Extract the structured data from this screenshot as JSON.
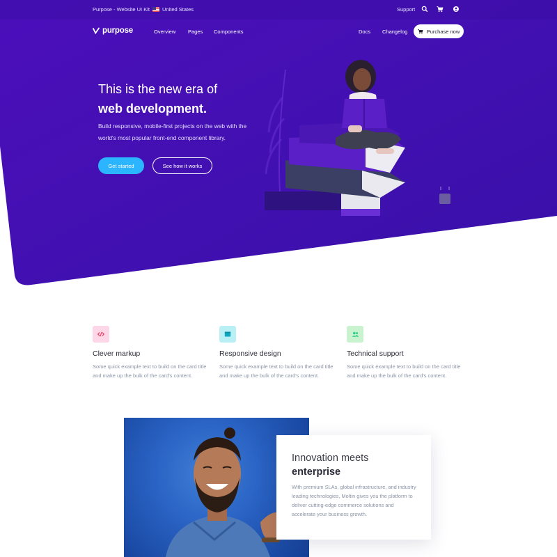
{
  "topbar": {
    "kit_label": "Purpose - Website UI Kit",
    "region": "United States",
    "support": "Support"
  },
  "nav": {
    "brand": "purpose",
    "links": [
      "Overview",
      "Pages",
      "Components"
    ],
    "right_links": [
      "Docs",
      "Changelog"
    ],
    "purchase": "Purchase now"
  },
  "hero": {
    "title_line1": "This is the new era of",
    "title_line2": "web development.",
    "subtitle": "Build responsive, mobile-first projects on the web with the world's most popular front-end component library.",
    "primary_button": "Get started",
    "secondary_button": "See how it works"
  },
  "features": [
    {
      "icon": "code-icon",
      "title": "Clever markup",
      "text": "Some quick example text to build on the card title and make up the bulk of the card's content."
    },
    {
      "icon": "browser-icon",
      "title": "Responsive design",
      "text": "Some quick example text to build on the card title and make up the bulk of the card's content."
    },
    {
      "icon": "users-icon",
      "title": "Technical support",
      "text": "Some quick example text to build on the card title and make up the bulk of the card's content."
    }
  ],
  "promo": {
    "title_line1": "Innovation meets",
    "title_line2": "enterprise",
    "text": "With premium SLAs, global infrastructure, and industry leading technologies, Moltin gives you the platform to deliver cutting-edge commerce solutions and accelerate your business growth."
  },
  "colors": {
    "hero_gradient_start": "#4a0fb8",
    "hero_gradient_end": "#3b0fa6",
    "accent_blue": "#2cb5ff",
    "feature_pink_bg": "#fdd6e7",
    "feature_cyan_bg": "#b9f0f5",
    "feature_green_bg": "#c9f2cf"
  }
}
